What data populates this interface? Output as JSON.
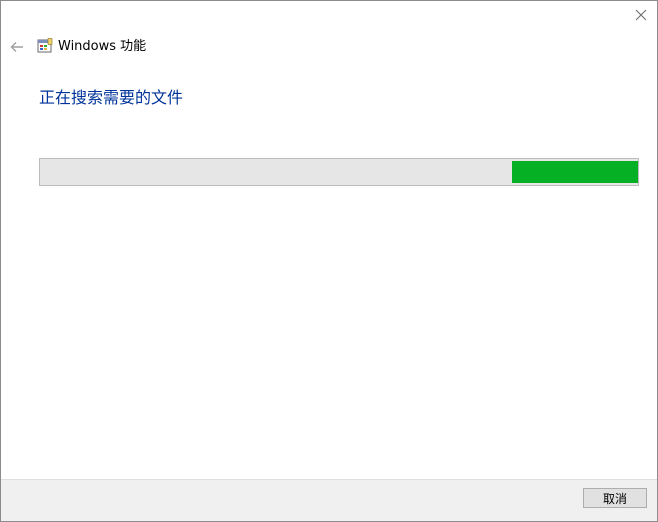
{
  "window": {
    "title": "Windows 功能",
    "app_icon": "windows-features-icon",
    "close_icon": "close-icon",
    "back_icon": "back-arrow-icon"
  },
  "main": {
    "heading": "正在搜索需要的文件",
    "progress": {
      "style": "marquee",
      "fill_start_fraction": 0.79,
      "fill_end_fraction": 1.0,
      "fill_color": "#06b025",
      "track_color": "#e6e6e6"
    }
  },
  "footer": {
    "cancel_label": "取消"
  },
  "colors": {
    "heading": "#003399",
    "footer_bg": "#f0f0f0"
  }
}
